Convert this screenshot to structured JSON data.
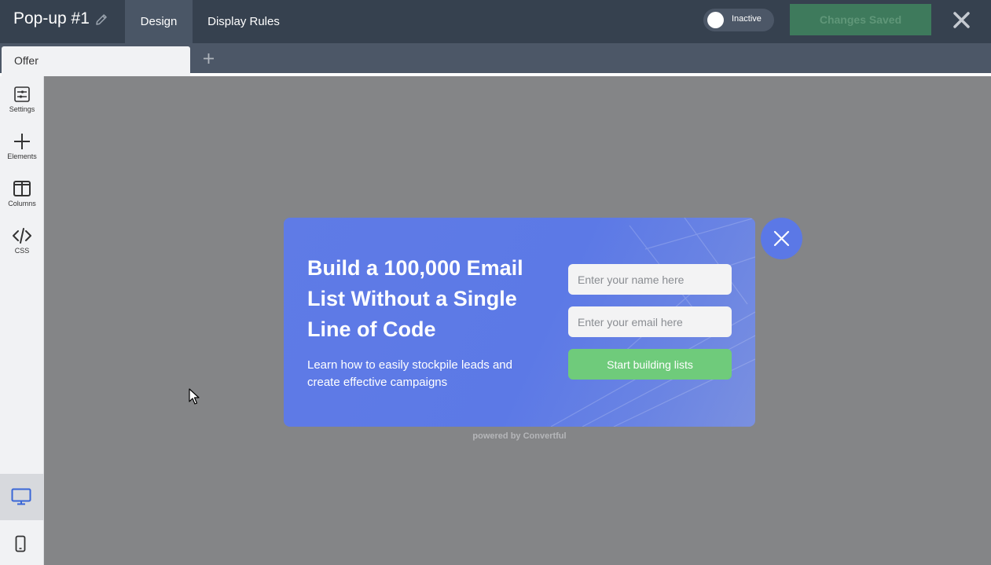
{
  "header": {
    "title": "Pop-up #1",
    "tabs": [
      {
        "label": "Design",
        "active": true
      },
      {
        "label": "Display Rules",
        "active": false
      }
    ],
    "status_toggle": {
      "label": "Inactive",
      "on": false
    },
    "save_button": "Changes Saved"
  },
  "page_tabs": [
    {
      "label": "Offer",
      "active": true
    }
  ],
  "sidebar": {
    "items": [
      {
        "label": "Settings",
        "icon": "settings-icon"
      },
      {
        "label": "Elements",
        "icon": "plus-icon"
      },
      {
        "label": "Columns",
        "icon": "columns-icon"
      },
      {
        "label": "CSS",
        "icon": "code-icon"
      }
    ],
    "devices": [
      {
        "icon": "desktop-icon",
        "active": true
      },
      {
        "icon": "mobile-icon",
        "active": false
      }
    ]
  },
  "popup": {
    "headline": "Build a 100,000 Email List Without a Single Line of Code",
    "subtext": "Learn how to easily stockpile leads and create effective campaigns",
    "name_placeholder": "Enter your name here",
    "email_placeholder": "Enter your email here",
    "submit_label": "Start building lists",
    "powered_by": "powered by Convertful"
  },
  "colors": {
    "topbar": "#36414f",
    "popup_bg": "#5c79e6",
    "submit": "#6fcb7b",
    "canvas": "#848587"
  }
}
